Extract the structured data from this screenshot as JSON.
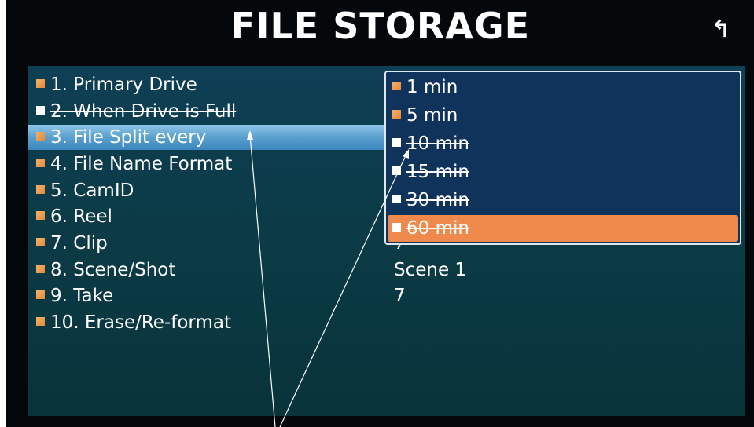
{
  "header": {
    "title": "FILE STORAGE",
    "back_icon": "↰"
  },
  "menu": {
    "items": [
      {
        "label": "1. Primary Drive",
        "checked": true,
        "disabled": false,
        "selected": false
      },
      {
        "label": "2. When Drive is Full",
        "checked": false,
        "disabled": true,
        "selected": false
      },
      {
        "label": "3. File Split every",
        "checked": true,
        "disabled": false,
        "selected": true
      },
      {
        "label": "4. File Name Format",
        "checked": true,
        "disabled": false,
        "selected": false
      },
      {
        "label": "5. CamID",
        "checked": true,
        "disabled": false,
        "selected": false
      },
      {
        "label": "6. Reel",
        "checked": true,
        "disabled": false,
        "selected": false
      },
      {
        "label": "7. Clip",
        "checked": true,
        "disabled": false,
        "selected": false
      },
      {
        "label": "8. Scene/Shot",
        "checked": true,
        "disabled": false,
        "selected": false
      },
      {
        "label": "9. Take",
        "checked": true,
        "disabled": false,
        "selected": false
      },
      {
        "label": "10. Erase/Re-format",
        "checked": true,
        "disabled": false,
        "selected": false
      }
    ]
  },
  "values": {
    "clip": "7",
    "scene_shot": "Scene 1",
    "take": "7"
  },
  "dropdown": {
    "options": [
      {
        "label": "1 min",
        "checked": true,
        "disabled": false,
        "selected": false
      },
      {
        "label": "5 min",
        "checked": true,
        "disabled": false,
        "selected": false
      },
      {
        "label": "10 min",
        "checked": false,
        "disabled": true,
        "selected": false
      },
      {
        "label": "15 min",
        "checked": false,
        "disabled": true,
        "selected": false
      },
      {
        "label": "30 min",
        "checked": false,
        "disabled": true,
        "selected": false
      },
      {
        "label": "60 min",
        "checked": false,
        "disabled": true,
        "selected": true
      }
    ]
  },
  "colors": {
    "checked": "#e7893a",
    "highlight_menu": "#5aa0cf",
    "highlight_option": "#ef8a4c",
    "dropdown_bg": "#10335c"
  }
}
